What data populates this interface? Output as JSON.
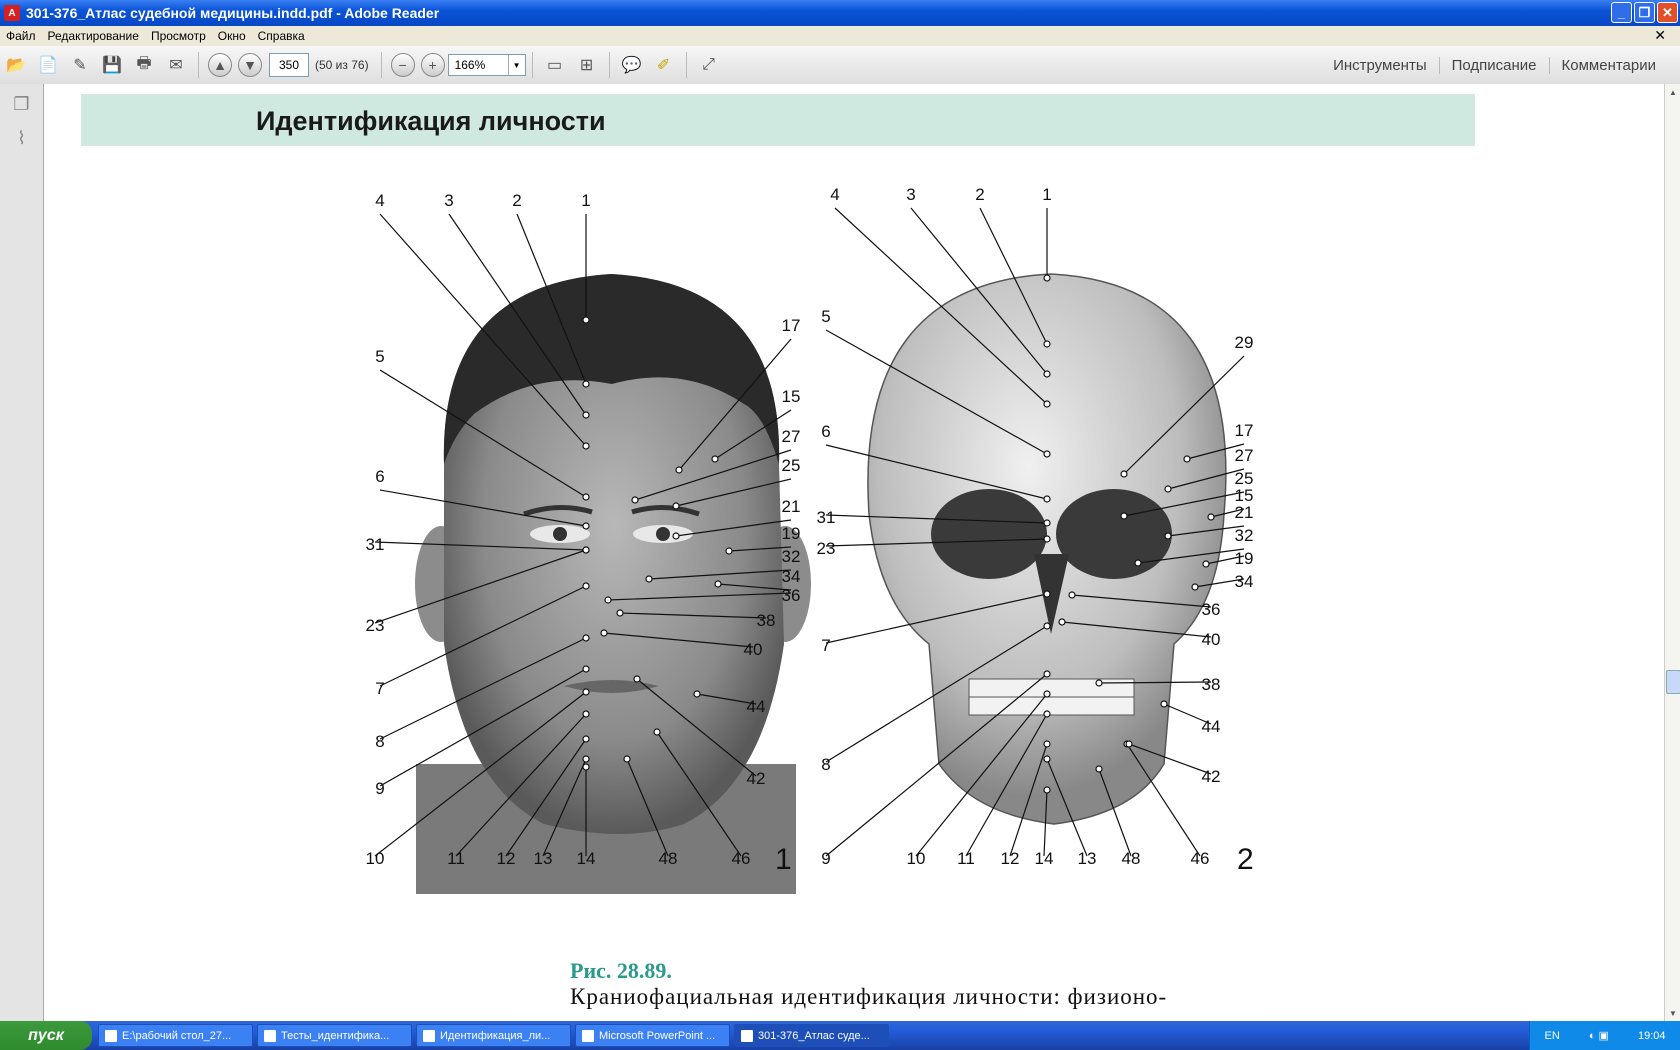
{
  "window": {
    "title": "301-376_Атлас судебной медицины.indd.pdf - Adobe Reader",
    "min_icon": "minimize-icon",
    "restore_icon": "restore-icon",
    "close_icon": "close-icon"
  },
  "menu": {
    "items": [
      "Файл",
      "Редактирование",
      "Просмотр",
      "Окно",
      "Справка"
    ]
  },
  "toolbar": {
    "page_number": "350",
    "page_count": "(50 из 76)",
    "zoom": "166%",
    "right_links": [
      "Инструменты",
      "Подписание",
      "Комментарии"
    ]
  },
  "document": {
    "section_title": "Идентификация личности",
    "figure_number": "Рис. 28.89.",
    "caption": "Краниофациальная идентификация личности: физионо-",
    "panel_labels": [
      "1",
      "2"
    ],
    "face_labels": [
      "1",
      "2",
      "3",
      "4",
      "5",
      "6",
      "31",
      "23",
      "7",
      "8",
      "9",
      "10",
      "11",
      "12",
      "13",
      "14",
      "48",
      "46",
      "17",
      "15",
      "27",
      "25",
      "21",
      "19",
      "32",
      "34",
      "36",
      "38",
      "40",
      "44",
      "42"
    ],
    "skull_labels": [
      "1",
      "2",
      "3",
      "4",
      "5",
      "6",
      "31",
      "23",
      "7",
      "8",
      "9",
      "10",
      "11",
      "12",
      "14",
      "13",
      "48",
      "46",
      "29",
      "17",
      "27",
      "25",
      "15",
      "21",
      "32",
      "19",
      "34",
      "36",
      "40",
      "38",
      "44",
      "42"
    ]
  },
  "taskbar": {
    "start": "пуск",
    "tasks": [
      "E:\\рабочий стол_27...",
      "Тесты_идентифика...",
      "Идентификация_ли...",
      "Microsoft PowerPoint ...",
      "301-376_Атлас суде..."
    ],
    "lang": "EN",
    "clock": "19:04"
  }
}
